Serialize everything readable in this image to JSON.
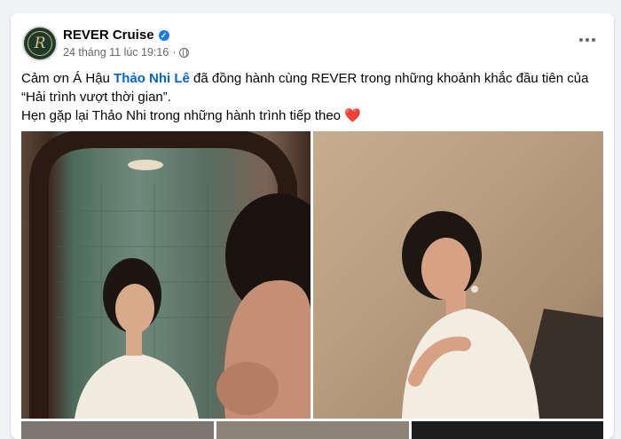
{
  "post": {
    "page_name": "REVER Cruise",
    "avatar_letter": "R",
    "timestamp": "24 tháng 11 lúc 19:16",
    "separator": "·",
    "text_line1_prefix": "Cảm ơn Á Hậu ",
    "mention": "Thảo Nhi Lê",
    "text_line1_suffix": " đã đồng hành cùng REVER trong những khoảnh khắc đầu tiên của “Hải trình vượt thời gian”.",
    "text_line2": "Hẹn gặp lại Thảo Nhi trong những hành trình tiếp theo ",
    "heart": "❤️"
  },
  "icons": {
    "verified": "verified-badge-icon",
    "privacy": "globe-icon",
    "more": "more-options-icon"
  },
  "colors": {
    "mention": "#0064d1",
    "verified": "#1877f2",
    "background": "#f0f2f5"
  }
}
